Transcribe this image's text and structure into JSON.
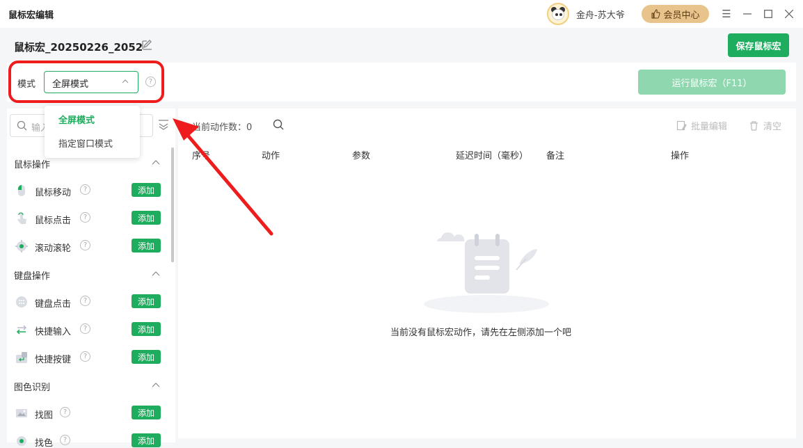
{
  "titlebar": {
    "title": "鼠标宏编辑",
    "username": "金舟-苏大爷",
    "vip_label": "会员中心"
  },
  "header": {
    "macro_name": "鼠标宏_20250226_2052",
    "save_label": "保存鼠标宏"
  },
  "mode": {
    "label": "模式",
    "selected": "全屏模式",
    "options": [
      "全屏模式",
      "指定窗口模式"
    ],
    "run_label": "运行鼠标宏（F11）"
  },
  "sidebar": {
    "search_placeholder": "输入",
    "add_label": "添加",
    "sections": [
      {
        "title": "鼠标操作",
        "items": [
          "鼠标移动",
          "鼠标点击",
          "滚动滚轮"
        ]
      },
      {
        "title": "键盘操作",
        "items": [
          "键盘点击",
          "快捷输入",
          "快捷按键"
        ]
      },
      {
        "title": "图色识别",
        "items": [
          "找图",
          "找色"
        ]
      }
    ]
  },
  "main": {
    "action_count_label": "当前动作数：0",
    "batch_edit": "批量编辑",
    "clear": "清空",
    "columns": [
      "序号",
      "动作",
      "参数",
      "延迟时间（毫秒）",
      "备注",
      "操作"
    ],
    "empty_text": "当前没有鼠标宏动作，请先在左侧添加一个吧"
  },
  "colors": {
    "accent": "#1eac5e",
    "accent_light": "#8fd8af",
    "highlight": "#ee1c1c",
    "vip": "#e8c48c"
  }
}
